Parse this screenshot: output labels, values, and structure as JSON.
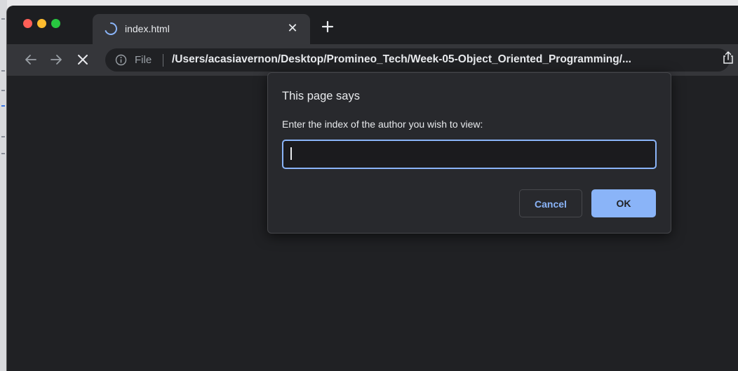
{
  "browser": {
    "tab": {
      "title": "index.html",
      "close_glyph": "✕"
    },
    "new_tab_glyph": "+",
    "omnibox": {
      "scheme_label": "File",
      "url": "/Users/acasiavernon/Desktop/Promineo_Tech/Week-05-Object_Oriented_Programming/..."
    }
  },
  "dialog": {
    "title": "This page says",
    "message": "Enter the index of the author you wish to view:",
    "input_value": "",
    "cancel_label": "Cancel",
    "ok_label": "OK"
  },
  "icons": {
    "back": "back-arrow-icon",
    "forward": "forward-arrow-icon",
    "stop": "stop-loading-icon",
    "info": "info-icon",
    "share": "share-icon",
    "spinner": "loading-spinner-icon"
  },
  "colors": {
    "accent": "#8ab4f8",
    "window_bg": "#202124",
    "toolbar_bg": "#35363a",
    "traffic_red": "#ff5f57",
    "traffic_yellow": "#febc2e",
    "traffic_green": "#28c840"
  }
}
